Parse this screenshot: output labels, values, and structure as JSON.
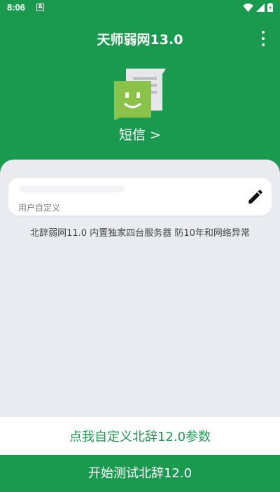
{
  "status_bar": {
    "time": "8:06",
    "notification_icon": "a-icon"
  },
  "app_bar": {
    "title": "天师弱网13.0",
    "menu_icon": "more-vert-icon"
  },
  "sms": {
    "icon": "sms-face-icon",
    "label": "短信 >"
  },
  "input": {
    "value": "",
    "label": "用户自定义",
    "edit_icon": "pencil-icon"
  },
  "info_text": "北辞弱网11.0 内置独家四台服务器 防10年和网络异常",
  "custom_button": "点我自定义北辞12.0参数",
  "start_button": "开始测试北辞12.0",
  "colors": {
    "primary": "#1a9a4f",
    "panel": "#eaebf0"
  }
}
